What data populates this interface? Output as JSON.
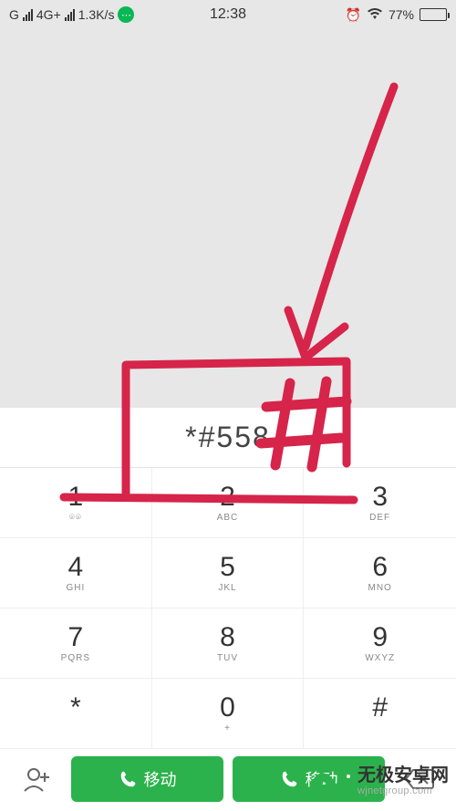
{
  "status": {
    "network_label": "G",
    "network_mode": "4G+",
    "data_rate": "1.3K/s",
    "time": "12:38",
    "battery_pct": "77%",
    "alarm_icon": "alarm-icon",
    "wifi_icon": "wifi-icon"
  },
  "dialer": {
    "display": "*#558",
    "keys": [
      {
        "digit": "1",
        "letters": ""
      },
      {
        "digit": "2",
        "letters": "ABC"
      },
      {
        "digit": "3",
        "letters": "DEF"
      },
      {
        "digit": "4",
        "letters": "GHI"
      },
      {
        "digit": "5",
        "letters": "JKL"
      },
      {
        "digit": "6",
        "letters": "MNO"
      },
      {
        "digit": "7",
        "letters": "PQRS"
      },
      {
        "digit": "8",
        "letters": "TUV"
      },
      {
        "digit": "9",
        "letters": "WXYZ"
      },
      {
        "digit": "*",
        "letters": ""
      },
      {
        "digit": "0",
        "letters": "+"
      },
      {
        "digit": "#",
        "letters": ""
      }
    ],
    "voicemail_symbol": "⌾⌾"
  },
  "bottom": {
    "call1_label": "移动",
    "call2_label": "移动"
  },
  "annotation": {
    "arrow": true,
    "box": true,
    "hash_overlay": "#",
    "color": "#d6244a"
  },
  "watermark": {
    "main": "无极安卓网",
    "sub": "wjnetgroup.com"
  }
}
